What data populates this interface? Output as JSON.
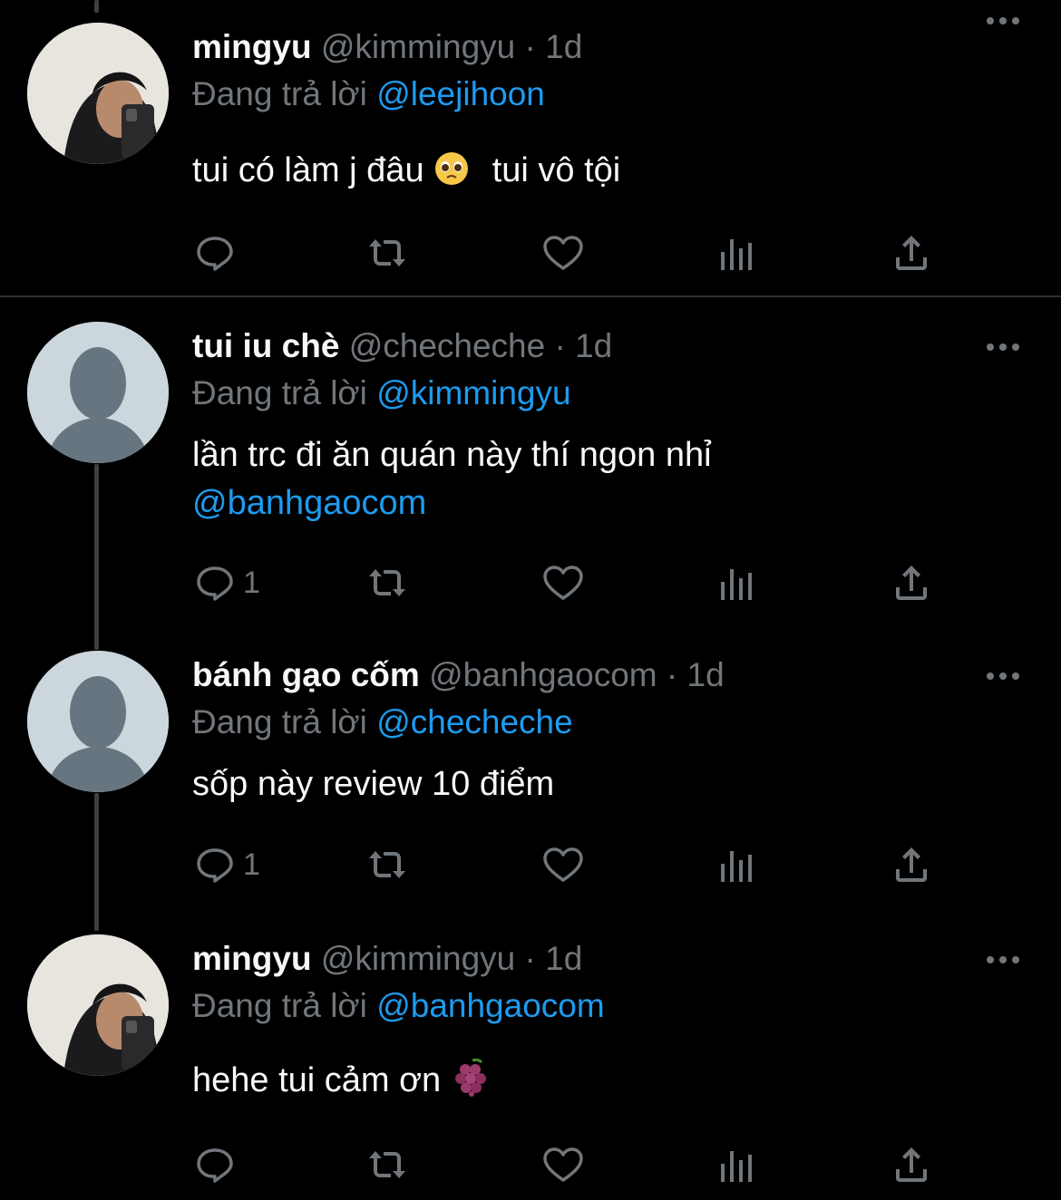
{
  "tweets": [
    {
      "name": "mingyu",
      "handle": "@kimmingyu",
      "dot": "·",
      "time": "1d",
      "replying_prefix": "Đang trả lời",
      "replying_to": "@leejihoon",
      "text": "tui có làm j đâu",
      "emoji": "pleading-face",
      "text_after": "tui vô tội",
      "reply_count": ""
    },
    {
      "name": "tui iu chè",
      "handle": "@checheche",
      "dot": "·",
      "time": "1d",
      "replying_prefix": "Đang trả lời",
      "replying_to": "@kimmingyu",
      "text": "lần trc đi ăn quán này thí ngon nhỉ",
      "mention": "@banhgaocom",
      "reply_count": "1"
    },
    {
      "name": "bánh gạo cốm",
      "handle": "@banhgaocom",
      "dot": "·",
      "time": "1d",
      "replying_prefix": "Đang trả lời",
      "replying_to": "@checheche",
      "text": "sốp này review 10 điểm",
      "reply_count": "1"
    },
    {
      "name": "mingyu",
      "handle": "@kimmingyu",
      "dot": "·",
      "time": "1d",
      "replying_prefix": "Đang trả lời",
      "replying_to": "@banhgaocom",
      "text": "hehe tui cảm ơn",
      "emoji": "grapes",
      "reply_count": ""
    }
  ],
  "icons": {
    "more": "more-icon",
    "reply": "reply-icon",
    "retweet": "retweet-icon",
    "like": "like-icon",
    "views": "views-icon",
    "share": "share-icon"
  },
  "colors": {
    "background": "#000000",
    "text": "#e7e9ea",
    "muted": "#71767b",
    "link": "#1d9bf0",
    "divider": "#2f3336",
    "thread_line": "#3c4044"
  }
}
